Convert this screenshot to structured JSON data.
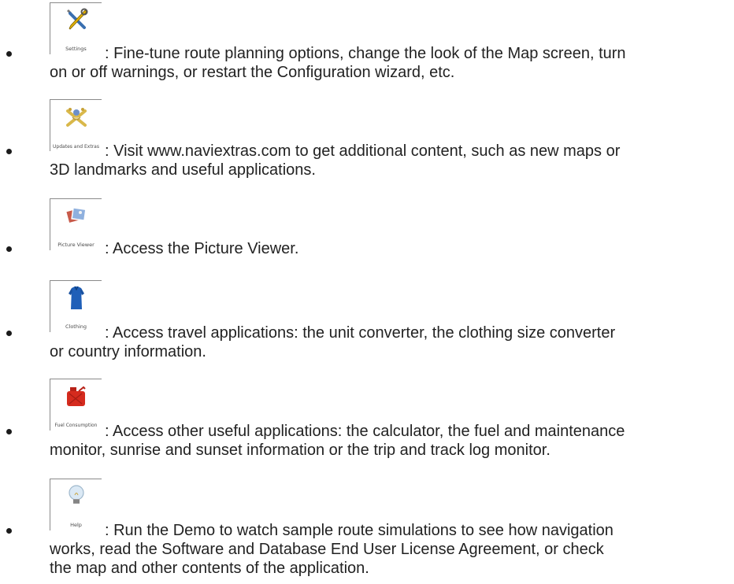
{
  "items": [
    {
      "icon": "settings-wrench-screwdriver-icon",
      "caption": "Settings",
      "lines": [
        ": Fine-tune route planning options, change the look of the Map screen, turn",
        "on or off warnings, or restart the Configuration wizard, etc."
      ]
    },
    {
      "icon": "updates-and-extras-icon",
      "caption": "Updates and Extras",
      "lines": [
        ": Visit www.naviextras.com to get additional content, such as new maps or",
        "3D landmarks and useful applications."
      ]
    },
    {
      "icon": "picture-viewer-icon",
      "caption": "Picture Viewer",
      "lines": [
        ": Access the Picture Viewer."
      ]
    },
    {
      "icon": "clothing-shirt-icon",
      "caption": "Clothing",
      "lines": [
        ": Access travel applications: the unit converter, the clothing size converter",
        "or country information."
      ]
    },
    {
      "icon": "fuel-consumption-can-icon",
      "caption": "Fuel Consumption",
      "lines": [
        ": Access other useful applications: the calculator, the fuel and maintenance",
        "monitor, sunrise and sunset information or the trip and track log monitor."
      ]
    },
    {
      "icon": "help-lightbulb-icon",
      "caption": "Help",
      "lines": [
        ": Run the Demo to watch sample route simulations to see how navigation",
        "works, read the Software and Database End User License Agreement, or check",
        "the map and other contents of the application."
      ]
    }
  ]
}
